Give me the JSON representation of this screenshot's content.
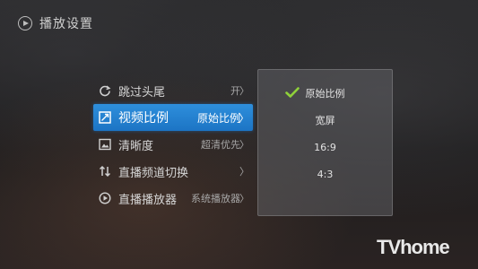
{
  "header": {
    "title": "播放设置",
    "icon": "play-circle-icon"
  },
  "menu": {
    "items": [
      {
        "label": "跳过头尾",
        "value": "开",
        "chevron": "〉",
        "icon": "refresh-icon",
        "active": false
      },
      {
        "label": "视频比例",
        "value": "原始比例",
        "chevron": "〉",
        "icon": "aspect-ratio-icon",
        "active": true
      },
      {
        "label": "清晰度",
        "value": "超清优先",
        "chevron": "〉",
        "icon": "image-icon",
        "active": false
      },
      {
        "label": "直播频道切换",
        "value": "",
        "chevron": "〉",
        "icon": "updown-arrows-icon",
        "active": false
      },
      {
        "label": "直播播放器",
        "value": "系统播放器",
        "chevron": "〉",
        "icon": "play-circle-icon",
        "active": false
      }
    ]
  },
  "options": {
    "items": [
      {
        "label": "原始比例",
        "selected": true
      },
      {
        "label": "宽屏",
        "selected": false
      },
      {
        "label": "16:9",
        "selected": false
      },
      {
        "label": "4:3",
        "selected": false
      }
    ]
  },
  "watermark": {
    "text": "TVhome"
  },
  "colors": {
    "accent": "#1f7bcb",
    "check": "#8fd13a"
  }
}
